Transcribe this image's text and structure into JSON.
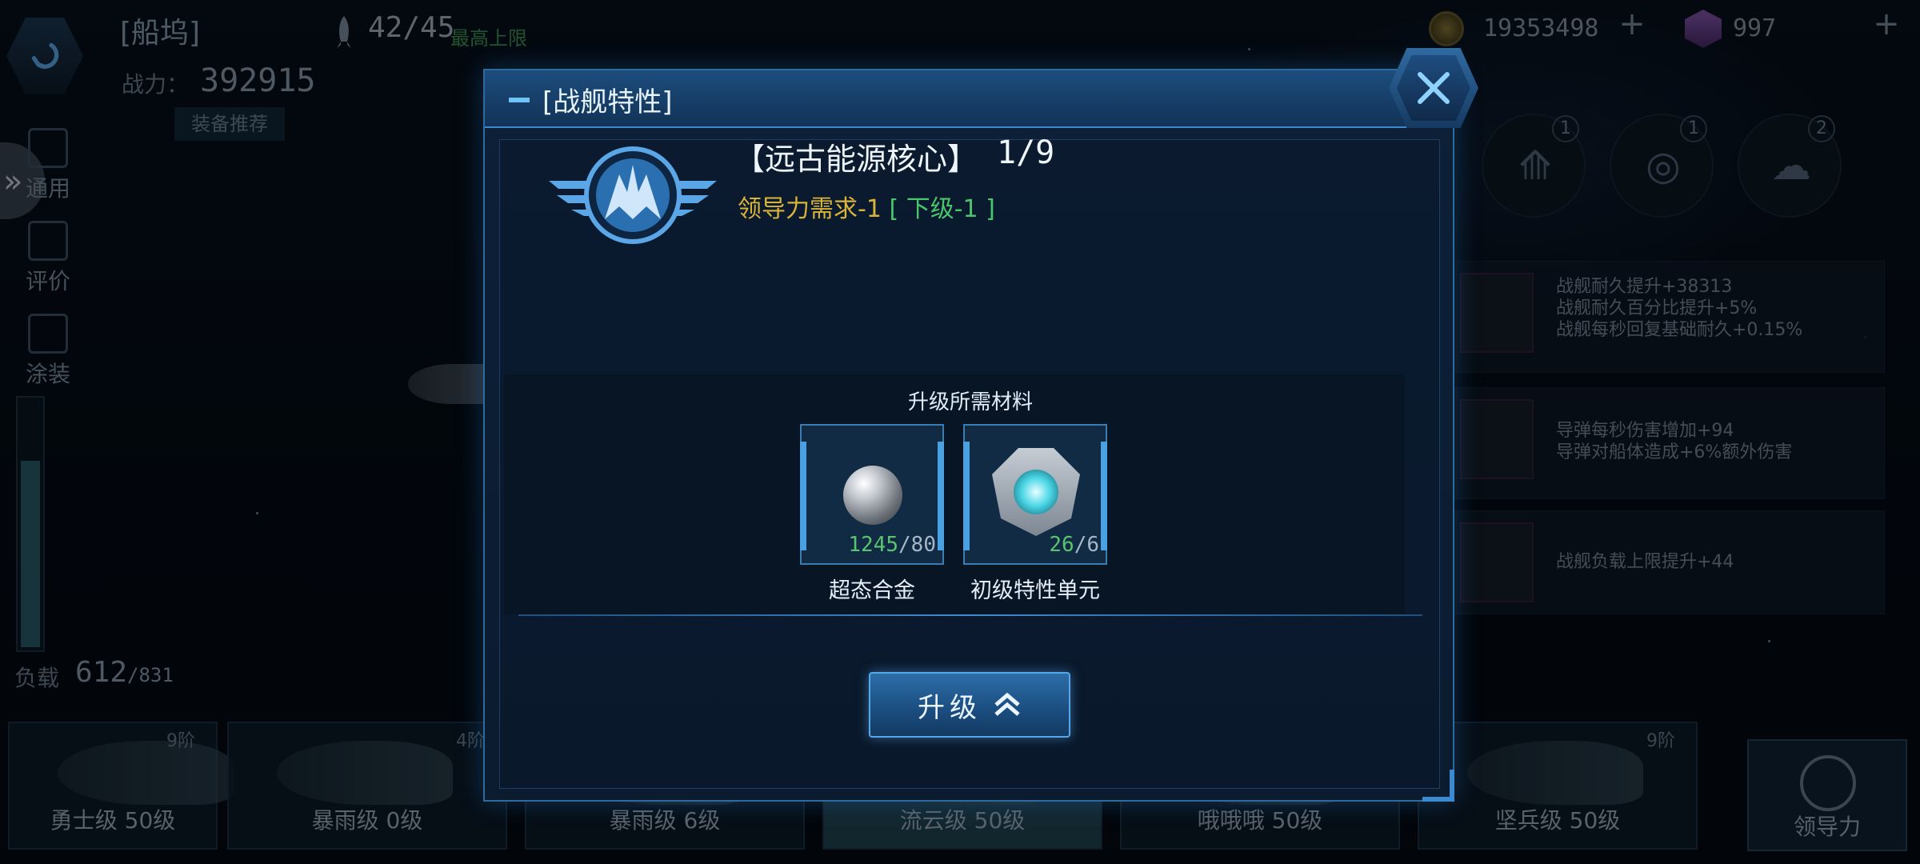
{
  "topbar": {
    "title": "[船坞]",
    "fleet_count": "42/45",
    "fleet_max_label": "最高上限",
    "coins": "19353498",
    "gems": "997",
    "plus_label": "+"
  },
  "left_panel": {
    "power_label": "战力：",
    "power_value": "392915",
    "equip_recommend": "装备推荐",
    "side_buttons": [
      {
        "label": "通用",
        "icon": "check-icon"
      },
      {
        "label": "评价",
        "icon": "star-card-icon"
      },
      {
        "label": "涂装",
        "icon": "spray-can-icon"
      }
    ],
    "load_label": "负载",
    "load_value": "612",
    "load_max": "/831",
    "load_fraction": 0.736
  },
  "right_panel": {
    "trait_icons": [
      {
        "count": "1",
        "icon": "wing-emblem-icon"
      },
      {
        "count": "1",
        "icon": "galaxy-icon"
      },
      {
        "count": "2",
        "icon": "cloud-icon"
      }
    ],
    "attributes": [
      {
        "lines": [
          "战舰耐久提升+38313",
          "战舰耐久百分比提升+5%",
          "战舰每秒回复基础耐久+0.15%"
        ]
      },
      {
        "lines": [
          "导弹每秒伤害增加+94",
          "导弹对船体造成+6%额外伤害"
        ]
      },
      {
        "lines": [
          "战舰负载上限提升+44"
        ]
      }
    ]
  },
  "ship_tabs": [
    {
      "name": "勇士级 50级",
      "tier": "9阶"
    },
    {
      "name": "暴雨级 0级",
      "tier": "4阶"
    },
    {
      "name": "暴雨级 6级",
      "tier": ""
    },
    {
      "name": "流云级 50级",
      "tier": ""
    },
    {
      "name": "哦哦哦 50级",
      "tier": ""
    },
    {
      "name": "坚兵级 50级",
      "tier": "9阶"
    }
  ],
  "leadership_button": {
    "label": "领导力",
    "icon": "gauge-icon"
  },
  "modal": {
    "title": "[战舰特性]",
    "trait_name": "【远古能源核心】",
    "trait_level": "1/9",
    "requirement": "领导力需求-1",
    "requirement_next": "[ 下级-1 ]",
    "materials_title": "升级所需材料",
    "materials": [
      {
        "name": "超态合金",
        "have": "1245",
        "need": "/80",
        "icon": "metal-orb-icon"
      },
      {
        "name": "初级特性单元",
        "have": "26",
        "need": "/6",
        "icon": "trait-unit-icon"
      }
    ],
    "upgrade_label": "升级",
    "close_icon": "close-icon"
  },
  "colors": {
    "accent": "#3b8ad0",
    "requirement": "#d9b43a",
    "positive": "#49c56b"
  }
}
